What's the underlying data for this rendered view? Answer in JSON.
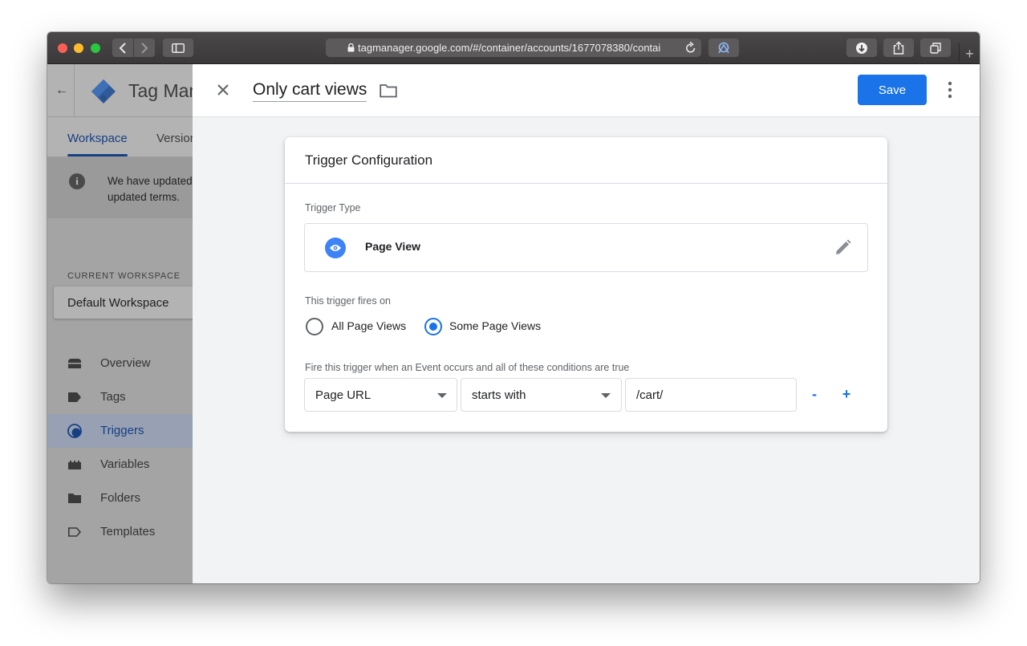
{
  "browser": {
    "url": "tagmanager.google.com/#/container/accounts/1677078380/contai",
    "icons": [
      "nav-back-icon",
      "nav-forward-icon",
      "sidebar-icon",
      "lock-icon",
      "reload-icon",
      "extension-icon",
      "download-icon",
      "share-icon",
      "tabs-icon",
      "new-tab-icon"
    ],
    "new_tab_glyph": "+"
  },
  "gtm": {
    "back_glyph": "←",
    "app_title": "Tag Manager",
    "tabs": {
      "workspace": "Workspace",
      "versions": "Versions"
    },
    "notice": {
      "line1": "We have updated",
      "line2": "updated terms.",
      "icon_glyph": "i"
    },
    "current_workspace_label": "CURRENT WORKSPACE",
    "workspace_name": "Default Workspace",
    "nav": [
      {
        "label": "Overview",
        "icon": "overview-icon"
      },
      {
        "label": "Tags",
        "icon": "tag-icon"
      },
      {
        "label": "Triggers",
        "icon": "trigger-icon",
        "active": true
      },
      {
        "label": "Variables",
        "icon": "variables-icon"
      },
      {
        "label": "Folders",
        "icon": "folder-icon"
      },
      {
        "label": "Templates",
        "icon": "template-icon"
      }
    ]
  },
  "editor": {
    "trigger_name": "Only cart views",
    "save_label": "Save",
    "card_title": "Trigger Configuration",
    "trigger_type_label": "Trigger Type",
    "trigger_type": "Page View",
    "fires_on_label": "This trigger fires on",
    "radio_options": [
      {
        "label": "All Page Views",
        "checked": false
      },
      {
        "label": "Some Page Views",
        "checked": true
      }
    ],
    "condition_label": "Fire this trigger when an Event occurs and all of these conditions are true",
    "condition": {
      "variable": "Page URL",
      "operator": "starts with",
      "value": "/cart/"
    },
    "minus_glyph": "-",
    "plus_glyph": "+"
  },
  "colors": {
    "accent": "#1a73e8",
    "active_nav_text": "#163f82",
    "sidebar_overlay": "#a4a4a4",
    "panel_bg": "#f1f3f4"
  }
}
